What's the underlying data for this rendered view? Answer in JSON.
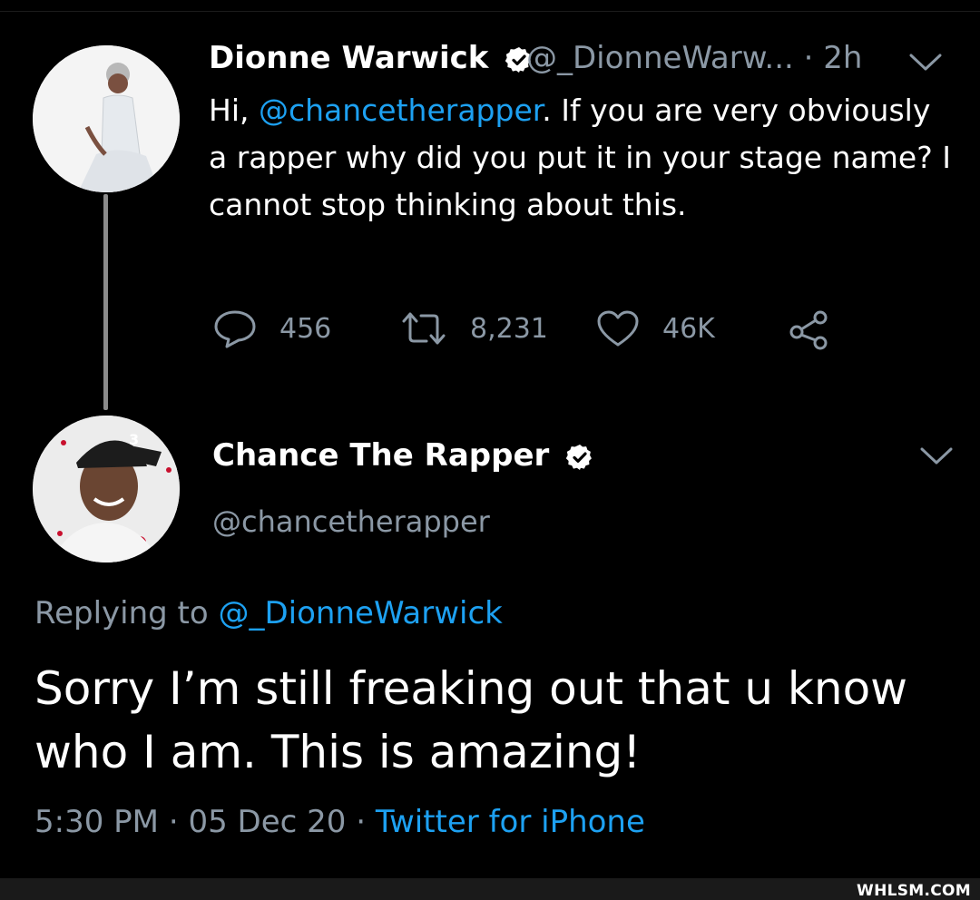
{
  "tweet_1": {
    "author_name": "Dionne Warwick",
    "author_handle": "@_DionneWarw...",
    "time": "· 2h",
    "text_greeting": "Hi, ",
    "text_mention": "@chancetherapper",
    "text_body": ". If you are very obviously a rapper why did you put it in your stage name? I cannot stop thinking about this.",
    "replies": "456",
    "retweets": "8,231",
    "likes": "46K"
  },
  "tweet_2": {
    "author_name": "Chance The Rapper",
    "author_handle": "@chancetherapper",
    "replying_label": "Replying to ",
    "replying_handle": "@_DionneWarwick",
    "text": "Sorry I’m still freaking out that u know who I am. This is amazing!",
    "time": "5:30 PM",
    "date": "05 Dec 20",
    "separator": "·",
    "source": "Twitter for iPhone"
  },
  "watermark": "WHLSM.COM",
  "colors": {
    "background": "#000000",
    "accent": "#1da1f2",
    "muted": "#8b98a5",
    "text": "#ffffff"
  },
  "icons": [
    "verified-badge-icon",
    "chevron-down-icon",
    "reply-icon",
    "retweet-icon",
    "like-icon",
    "share-icon"
  ]
}
